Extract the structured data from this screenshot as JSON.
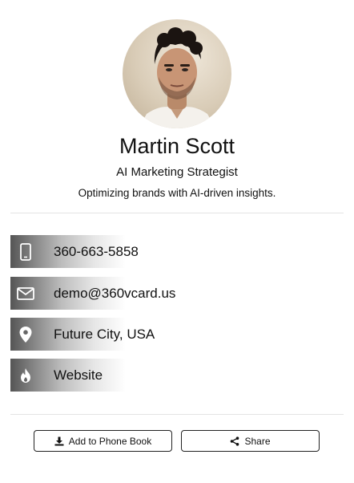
{
  "profile": {
    "name": "Martin Scott",
    "role": "AI Marketing Strategist",
    "tagline": "Optimizing brands with AI-driven insights."
  },
  "contacts": [
    {
      "icon": "phone-icon",
      "label": "360-663-5858"
    },
    {
      "icon": "email-icon",
      "label": "demo@360vcard.us"
    },
    {
      "icon": "location-pin-icon",
      "label": "Future City, USA"
    },
    {
      "icon": "website-icon",
      "label": "Website"
    }
  ],
  "actions": {
    "add_contact": "Add to Phone Book",
    "share": "Share"
  },
  "colors": {
    "icon_bg_dark": "#555555",
    "border": "#222222",
    "divider": "#e3e3e3"
  }
}
